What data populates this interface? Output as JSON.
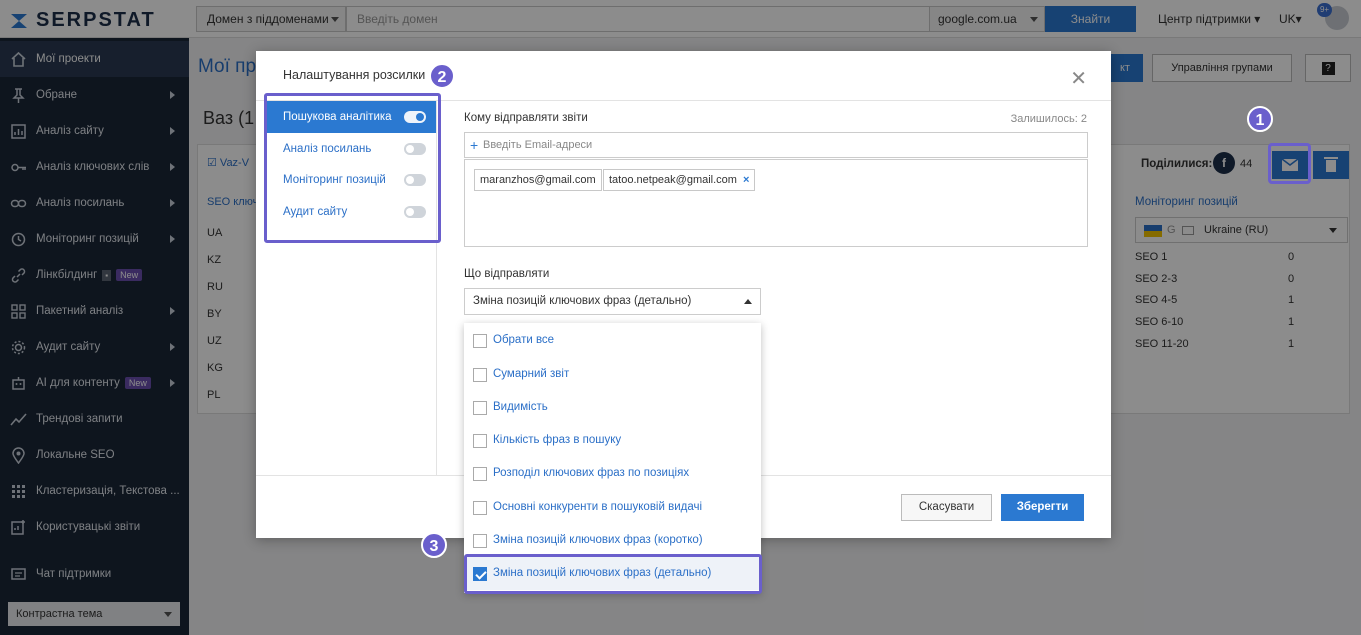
{
  "topbar": {
    "logo": "SERPSTAT",
    "domain_mode": "Домен з піддоменами",
    "domain_placeholder": "Введіть домен",
    "region": "google.com.ua",
    "search_button": "Знайти",
    "support": "Центр підтримки",
    "lang": "UK",
    "notif_count": "9+"
  },
  "sidebar": {
    "items": [
      {
        "label": "Мої проекти",
        "icon": "home-icon"
      },
      {
        "label": "Обране",
        "icon": "pin-icon"
      },
      {
        "label": "Аналіз сайту",
        "icon": "chart-icon"
      },
      {
        "label": "Аналіз ключових слів",
        "icon": "key-icon"
      },
      {
        "label": "Аналіз посилань",
        "icon": "link-icon"
      },
      {
        "label": "Моніторинг позицій",
        "icon": "history-icon"
      },
      {
        "label": "Лінкбілдинг",
        "icon": "chain-icon",
        "badge": "New"
      },
      {
        "label": "Пакетний аналіз",
        "icon": "grid-icon"
      },
      {
        "label": "Аудит сайту",
        "icon": "gear-icon"
      },
      {
        "label": "AI для контенту",
        "icon": "robot-icon",
        "badge": "New"
      },
      {
        "label": "Трендові запити",
        "icon": "trend-icon"
      },
      {
        "label": "Локальне SEO",
        "icon": "location-icon"
      },
      {
        "label": "Кластеризація, Текстова ...",
        "icon": "dots-grid-icon"
      },
      {
        "label": "Користувацькі звіти",
        "icon": "report-icon"
      },
      {
        "label": "Чат підтримки",
        "icon": "chat-icon"
      }
    ],
    "theme": "Контрастна тема"
  },
  "main": {
    "title": "Мої прое",
    "project": "Ваз (1",
    "project_link": "Vaz-V",
    "mgmt_button": "Управління групами",
    "blue_button": "кт",
    "share_label": "Поділилися:",
    "share_count": "44",
    "seo_header": "SEO ключ",
    "countries": [
      "UA",
      "KZ",
      "RU",
      "BY",
      "UZ",
      "KG",
      "PL"
    ],
    "monitoring_title": "Моніторинг позицій",
    "monitoring_region": "Ukraine (RU)",
    "seo_rows": [
      {
        "label": "SEO 1",
        "value": "0"
      },
      {
        "label": "SEO 2-3",
        "value": "0"
      },
      {
        "label": "SEO 4-5",
        "value": "1"
      },
      {
        "label": "SEO 6-10",
        "value": "1"
      },
      {
        "label": "SEO 11-20",
        "value": "1"
      }
    ]
  },
  "modal": {
    "title": "Налаштування розсилки",
    "tabs": [
      {
        "label": "Пошукова аналітика",
        "active": true
      },
      {
        "label": "Аналіз посилань",
        "active": false
      },
      {
        "label": "Моніторинг позицій",
        "active": false
      },
      {
        "label": "Аудит сайту",
        "active": false
      }
    ],
    "recipients_label": "Кому відправляти звіти",
    "remaining": "Залишилось: 2",
    "email_placeholder": "Введіть Email-адреси",
    "emails": [
      "maranzhos@gmail.com",
      "tatoo.netpeak@gmail.com"
    ],
    "what_label": "Що відправляти",
    "what_selected": "Зміна позицій ключових фраз (детально)",
    "options": [
      {
        "label": "Обрати все",
        "checked": false
      },
      {
        "label": "Сумарний звіт",
        "checked": false
      },
      {
        "label": "Видимість",
        "checked": false
      },
      {
        "label": "Кількість фраз в пошуку",
        "checked": false
      },
      {
        "label": "Розподіл ключових фраз по позиціях",
        "checked": false
      },
      {
        "label": "Основні конкуренти в пошуковій видачі",
        "checked": false
      },
      {
        "label": "Зміна позицій ключових фраз (коротко)",
        "checked": false
      },
      {
        "label": "Зміна позицій ключових фраз (детально)",
        "checked": true
      }
    ],
    "cancel": "Скасувати",
    "save": "Зберегти"
  },
  "callouts": [
    "1",
    "2",
    "3"
  ],
  "colors": {
    "accent": "#2b79d1",
    "sidebar": "#1b2738",
    "callout": "#6a5fcc"
  }
}
